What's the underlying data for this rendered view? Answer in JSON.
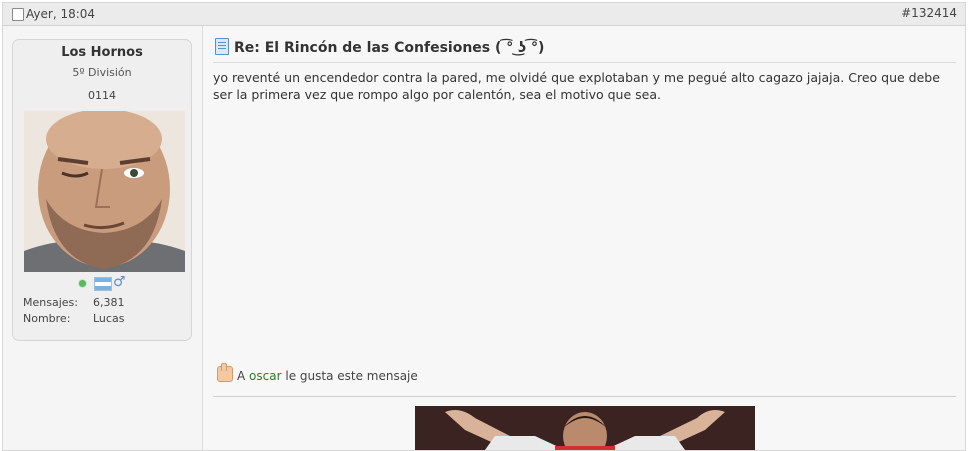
{
  "post": {
    "date": "Ayer, 18:04",
    "number": "#132414",
    "title": "Re: El Rincón de las Confesiones ( ͡° ͜ʖ ͡°)",
    "body": "yo reventé un encendedor contra la pared, me olvidé que explotaban y me pegué alto cagazo jajaja. Creo que debe ser la primera vez que rompo algo por calentón, sea el motivo que sea.",
    "like": {
      "prefix": "A",
      "user": "oscar",
      "suffix": "le gusta este mensaje"
    }
  },
  "author": {
    "name": "Los Hornos",
    "rank": "5º División",
    "id": "0114",
    "stats": [
      {
        "label": "Mensajes:",
        "value": "6,381"
      },
      {
        "label": "Nombre:",
        "value": "Lucas"
      }
    ],
    "icons": [
      "online-status-icon",
      "argentina-flag-icon",
      "male-gender-icon"
    ]
  },
  "colors": {
    "header_bg": "#ebebeb",
    "panel_bg": "#efefef",
    "like_user": "#2b7a2b",
    "title_icon": "#5b8ec6"
  }
}
